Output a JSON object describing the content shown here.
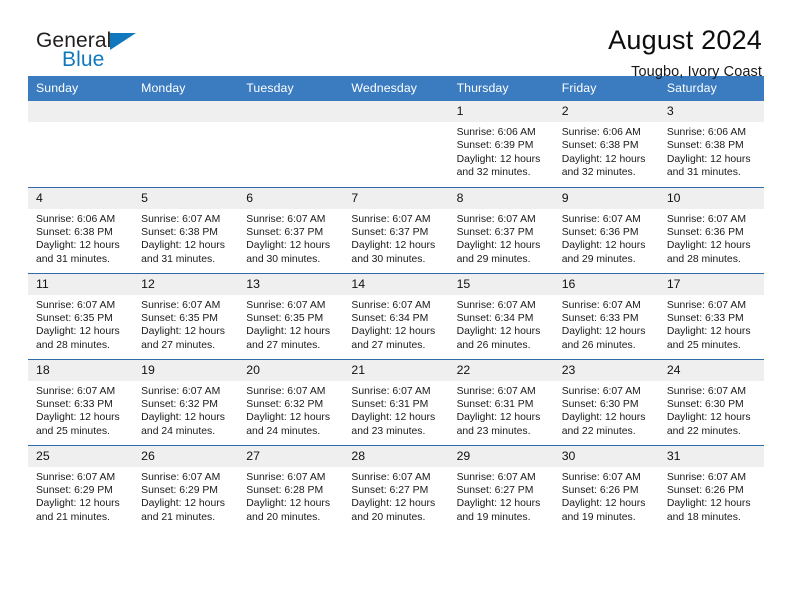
{
  "logo": {
    "word_one": "General",
    "word_two": "Blue",
    "triangle_icon": "blue-triangle-icon",
    "accent_color": "#1278be"
  },
  "header": {
    "title": "August 2024",
    "subtitle": "Tougbo, Ivory Coast"
  },
  "theme": {
    "header_blue": "#3b7cc0",
    "row_border": "#2d6ca8",
    "daynum_band": "#efefef"
  },
  "calendar": {
    "weekday_headers": [
      "Sunday",
      "Monday",
      "Tuesday",
      "Wednesday",
      "Thursday",
      "Friday",
      "Saturday"
    ],
    "labels": {
      "sunrise": "Sunrise:",
      "sunset": "Sunset:",
      "daylight": "Daylight:"
    },
    "weeks": [
      [
        {
          "day": "",
          "empty": true
        },
        {
          "day": "",
          "empty": true
        },
        {
          "day": "",
          "empty": true
        },
        {
          "day": "",
          "empty": true
        },
        {
          "day": "1",
          "line1": "Sunrise: 6:06 AM",
          "line2": "Sunset: 6:39 PM",
          "line3": "Daylight: 12 hours",
          "line4": "and 32 minutes."
        },
        {
          "day": "2",
          "line1": "Sunrise: 6:06 AM",
          "line2": "Sunset: 6:38 PM",
          "line3": "Daylight: 12 hours",
          "line4": "and 32 minutes."
        },
        {
          "day": "3",
          "line1": "Sunrise: 6:06 AM",
          "line2": "Sunset: 6:38 PM",
          "line3": "Daylight: 12 hours",
          "line4": "and 31 minutes."
        }
      ],
      [
        {
          "day": "4",
          "line1": "Sunrise: 6:06 AM",
          "line2": "Sunset: 6:38 PM",
          "line3": "Daylight: 12 hours",
          "line4": "and 31 minutes."
        },
        {
          "day": "5",
          "line1": "Sunrise: 6:07 AM",
          "line2": "Sunset: 6:38 PM",
          "line3": "Daylight: 12 hours",
          "line4": "and 31 minutes."
        },
        {
          "day": "6",
          "line1": "Sunrise: 6:07 AM",
          "line2": "Sunset: 6:37 PM",
          "line3": "Daylight: 12 hours",
          "line4": "and 30 minutes."
        },
        {
          "day": "7",
          "line1": "Sunrise: 6:07 AM",
          "line2": "Sunset: 6:37 PM",
          "line3": "Daylight: 12 hours",
          "line4": "and 30 minutes."
        },
        {
          "day": "8",
          "line1": "Sunrise: 6:07 AM",
          "line2": "Sunset: 6:37 PM",
          "line3": "Daylight: 12 hours",
          "line4": "and 29 minutes."
        },
        {
          "day": "9",
          "line1": "Sunrise: 6:07 AM",
          "line2": "Sunset: 6:36 PM",
          "line3": "Daylight: 12 hours",
          "line4": "and 29 minutes."
        },
        {
          "day": "10",
          "line1": "Sunrise: 6:07 AM",
          "line2": "Sunset: 6:36 PM",
          "line3": "Daylight: 12 hours",
          "line4": "and 28 minutes."
        }
      ],
      [
        {
          "day": "11",
          "line1": "Sunrise: 6:07 AM",
          "line2": "Sunset: 6:35 PM",
          "line3": "Daylight: 12 hours",
          "line4": "and 28 minutes."
        },
        {
          "day": "12",
          "line1": "Sunrise: 6:07 AM",
          "line2": "Sunset: 6:35 PM",
          "line3": "Daylight: 12 hours",
          "line4": "and 27 minutes."
        },
        {
          "day": "13",
          "line1": "Sunrise: 6:07 AM",
          "line2": "Sunset: 6:35 PM",
          "line3": "Daylight: 12 hours",
          "line4": "and 27 minutes."
        },
        {
          "day": "14",
          "line1": "Sunrise: 6:07 AM",
          "line2": "Sunset: 6:34 PM",
          "line3": "Daylight: 12 hours",
          "line4": "and 27 minutes."
        },
        {
          "day": "15",
          "line1": "Sunrise: 6:07 AM",
          "line2": "Sunset: 6:34 PM",
          "line3": "Daylight: 12 hours",
          "line4": "and 26 minutes."
        },
        {
          "day": "16",
          "line1": "Sunrise: 6:07 AM",
          "line2": "Sunset: 6:33 PM",
          "line3": "Daylight: 12 hours",
          "line4": "and 26 minutes."
        },
        {
          "day": "17",
          "line1": "Sunrise: 6:07 AM",
          "line2": "Sunset: 6:33 PM",
          "line3": "Daylight: 12 hours",
          "line4": "and 25 minutes."
        }
      ],
      [
        {
          "day": "18",
          "line1": "Sunrise: 6:07 AM",
          "line2": "Sunset: 6:33 PM",
          "line3": "Daylight: 12 hours",
          "line4": "and 25 minutes."
        },
        {
          "day": "19",
          "line1": "Sunrise: 6:07 AM",
          "line2": "Sunset: 6:32 PM",
          "line3": "Daylight: 12 hours",
          "line4": "and 24 minutes."
        },
        {
          "day": "20",
          "line1": "Sunrise: 6:07 AM",
          "line2": "Sunset: 6:32 PM",
          "line3": "Daylight: 12 hours",
          "line4": "and 24 minutes."
        },
        {
          "day": "21",
          "line1": "Sunrise: 6:07 AM",
          "line2": "Sunset: 6:31 PM",
          "line3": "Daylight: 12 hours",
          "line4": "and 23 minutes."
        },
        {
          "day": "22",
          "line1": "Sunrise: 6:07 AM",
          "line2": "Sunset: 6:31 PM",
          "line3": "Daylight: 12 hours",
          "line4": "and 23 minutes."
        },
        {
          "day": "23",
          "line1": "Sunrise: 6:07 AM",
          "line2": "Sunset: 6:30 PM",
          "line3": "Daylight: 12 hours",
          "line4": "and 22 minutes."
        },
        {
          "day": "24",
          "line1": "Sunrise: 6:07 AM",
          "line2": "Sunset: 6:30 PM",
          "line3": "Daylight: 12 hours",
          "line4": "and 22 minutes."
        }
      ],
      [
        {
          "day": "25",
          "line1": "Sunrise: 6:07 AM",
          "line2": "Sunset: 6:29 PM",
          "line3": "Daylight: 12 hours",
          "line4": "and 21 minutes."
        },
        {
          "day": "26",
          "line1": "Sunrise: 6:07 AM",
          "line2": "Sunset: 6:29 PM",
          "line3": "Daylight: 12 hours",
          "line4": "and 21 minutes."
        },
        {
          "day": "27",
          "line1": "Sunrise: 6:07 AM",
          "line2": "Sunset: 6:28 PM",
          "line3": "Daylight: 12 hours",
          "line4": "and 20 minutes."
        },
        {
          "day": "28",
          "line1": "Sunrise: 6:07 AM",
          "line2": "Sunset: 6:27 PM",
          "line3": "Daylight: 12 hours",
          "line4": "and 20 minutes."
        },
        {
          "day": "29",
          "line1": "Sunrise: 6:07 AM",
          "line2": "Sunset: 6:27 PM",
          "line3": "Daylight: 12 hours",
          "line4": "and 19 minutes."
        },
        {
          "day": "30",
          "line1": "Sunrise: 6:07 AM",
          "line2": "Sunset: 6:26 PM",
          "line3": "Daylight: 12 hours",
          "line4": "and 19 minutes."
        },
        {
          "day": "31",
          "line1": "Sunrise: 6:07 AM",
          "line2": "Sunset: 6:26 PM",
          "line3": "Daylight: 12 hours",
          "line4": "and 18 minutes."
        }
      ]
    ]
  }
}
